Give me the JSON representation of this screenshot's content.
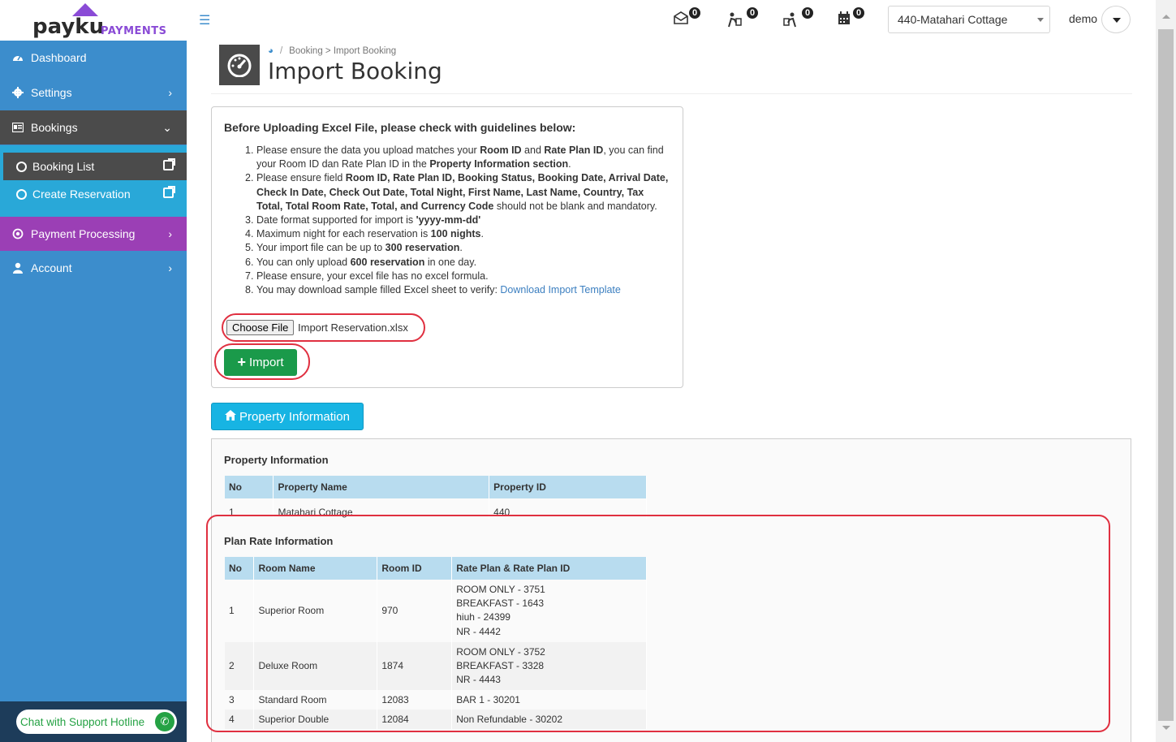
{
  "brand": {
    "name": "payku",
    "sub": "PAYMENTS"
  },
  "sidebar": {
    "items": [
      {
        "label": "Dashboard",
        "icon": "dashboard-icon"
      },
      {
        "label": "Settings",
        "icon": "gear-icon"
      },
      {
        "label": "Bookings",
        "icon": "bookings-icon"
      },
      {
        "label": "Payment Processing",
        "icon": "payment-icon"
      },
      {
        "label": "Account",
        "icon": "user-icon"
      }
    ],
    "sub_items": [
      {
        "label": "Booking List"
      },
      {
        "label": "Create Reservation"
      }
    ],
    "chat_label": "Chat with Support Hotline"
  },
  "header": {
    "badges": [
      "0",
      "0",
      "0",
      "0"
    ],
    "property_selected": "440-Matahari Cottage",
    "user": "demo"
  },
  "page": {
    "breadcrumb": "Booking > Import Booking",
    "title": "Import Booking"
  },
  "guidelines": {
    "title": "Before Uploading Excel File, please check with guidelines below:",
    "download_link": "Download Import Template"
  },
  "file_input": {
    "button": "Choose File",
    "file_name": "Import Reservation.xlsx"
  },
  "import_button": "Import",
  "property_button": "Property Information",
  "property_info": {
    "title": "Property Information",
    "headers": [
      "No",
      "Property Name",
      "Property ID"
    ],
    "rows": [
      {
        "no": "1",
        "name": "Matahari Cottage",
        "id": "440"
      }
    ]
  },
  "plan_rate": {
    "title": "Plan Rate Information",
    "headers": [
      "No",
      "Room Name",
      "Room ID",
      "Rate Plan & Rate Plan ID"
    ],
    "rows": [
      {
        "no": "1",
        "room": "Superior Room",
        "room_id": "970",
        "plans": [
          "ROOM ONLY - 3751",
          "BREAKFAST - 1643",
          "hiuh - 24399",
          "NR - 4442"
        ]
      },
      {
        "no": "2",
        "room": "Deluxe Room",
        "room_id": "1874",
        "plans": [
          "ROOM ONLY - 3752",
          "BREAKFAST - 3328",
          "NR - 4443"
        ]
      },
      {
        "no": "3",
        "room": "Standard Room",
        "room_id": "12083",
        "plans": [
          "BAR 1 - 30201"
        ]
      },
      {
        "no": "4",
        "room": "Superior Double",
        "room_id": "12084",
        "plans": [
          "Non Refundable - 30202"
        ]
      }
    ]
  },
  "colors": {
    "sidebar": "#3c8dcc",
    "accent_purple": "#9b3fb5",
    "import_green": "#1a9a4a",
    "info_blue": "#17b4e3",
    "highlight_red": "#e03040"
  }
}
